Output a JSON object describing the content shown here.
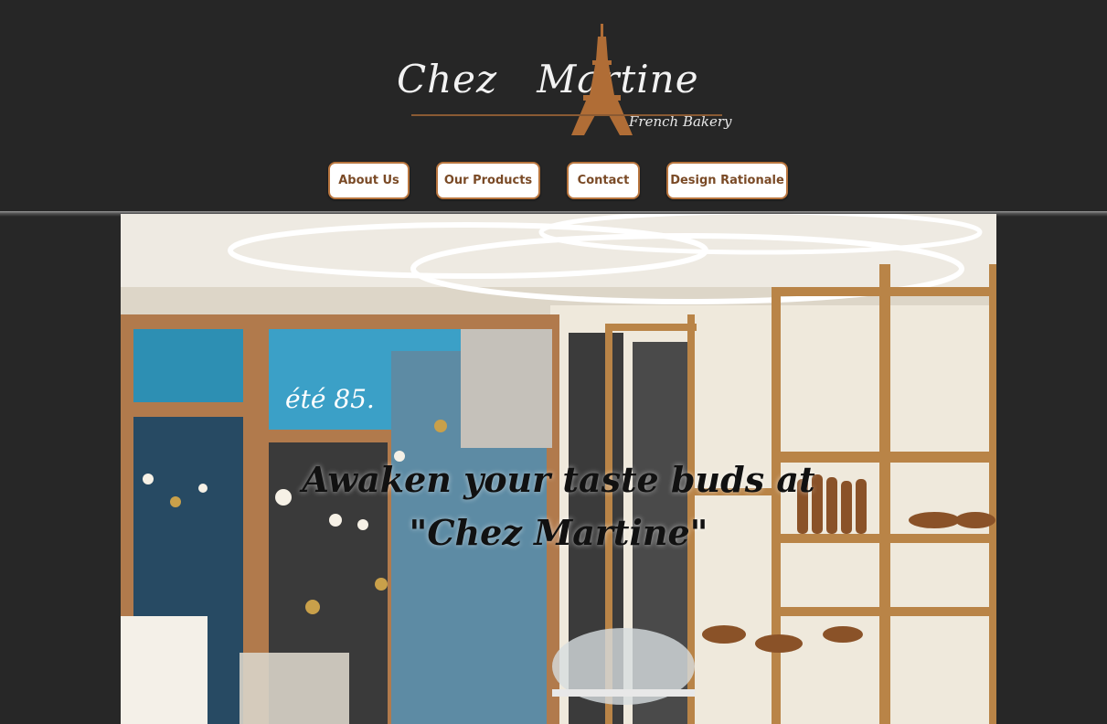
{
  "brand": {
    "name_first": "Chez",
    "name_second": "Martine",
    "tagline": "French Bakery"
  },
  "nav": {
    "items": [
      {
        "label": "About Us"
      },
      {
        "label": "Our Products"
      },
      {
        "label": "Contact"
      },
      {
        "label": "Design Rationale"
      }
    ]
  },
  "hero": {
    "line1": "Awaken your taste buds at",
    "line2": "\"Chez Martine\"",
    "window_sign": "été 85."
  },
  "colors": {
    "background": "#262626",
    "accent": "#b8753e",
    "button_text": "#7a4a26"
  }
}
